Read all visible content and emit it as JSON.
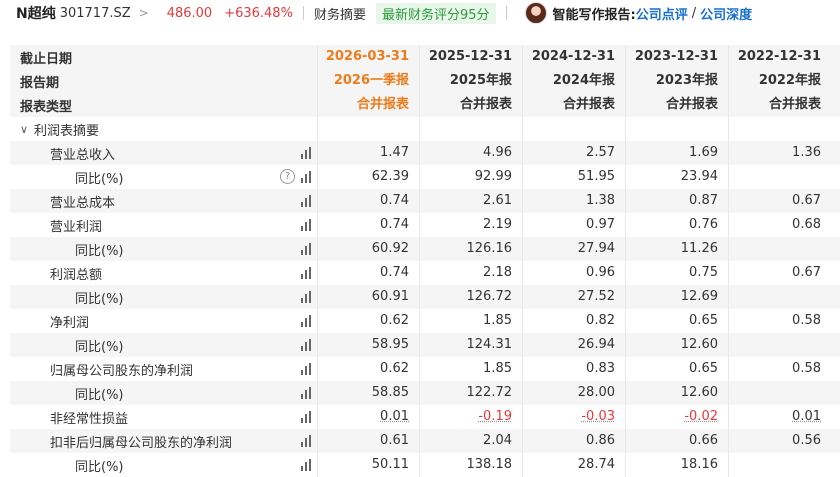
{
  "header": {
    "stock_name": "N超纯",
    "stock_code": "301717.SZ",
    "price": "486.00",
    "change_pct": "+636.48%",
    "summary_label": "财务摘要",
    "score_badge": "最新财务评分95分",
    "ai_label": "智能写作报告:",
    "link1": "公司点评",
    "link_sep": "/",
    "link2": "公司深度"
  },
  "table": {
    "header_labels": [
      "截止日期",
      "报告期",
      "报表类型"
    ],
    "columns": [
      {
        "date": "2026-03-31",
        "period": "2026一季报",
        "type": "合并报表"
      },
      {
        "date": "2025-12-31",
        "period": "2025年报",
        "type": "合并报表"
      },
      {
        "date": "2024-12-31",
        "period": "2024年报",
        "type": "合并报表"
      },
      {
        "date": "2023-12-31",
        "period": "2023年报",
        "type": "合并报表"
      },
      {
        "date": "2022-12-31",
        "period": "2022年报",
        "type": "合并报表"
      }
    ],
    "section": "利润表摘要",
    "rows": [
      {
        "label": "营业总收入",
        "v": [
          "1.47",
          "4.96",
          "2.57",
          "1.69",
          "1.36"
        ]
      },
      {
        "label": "同比(%)",
        "v": [
          "62.39",
          "92.99",
          "51.95",
          "23.94",
          ""
        ]
      },
      {
        "label": "营业总成本",
        "v": [
          "0.74",
          "2.61",
          "1.38",
          "0.87",
          "0.67"
        ]
      },
      {
        "label": "营业利润",
        "v": [
          "0.74",
          "2.19",
          "0.97",
          "0.76",
          "0.68"
        ]
      },
      {
        "label": "同比(%)",
        "v": [
          "60.92",
          "126.16",
          "27.94",
          "11.26",
          ""
        ]
      },
      {
        "label": "利润总额",
        "v": [
          "0.74",
          "2.18",
          "0.96",
          "0.75",
          "0.67"
        ]
      },
      {
        "label": "同比(%)",
        "v": [
          "60.91",
          "126.72",
          "27.52",
          "12.69",
          ""
        ]
      },
      {
        "label": "净利润",
        "v": [
          "0.62",
          "1.85",
          "0.82",
          "0.65",
          "0.58"
        ]
      },
      {
        "label": "同比(%)",
        "v": [
          "58.95",
          "124.31",
          "26.94",
          "12.60",
          ""
        ]
      },
      {
        "label": "归属母公司股东的净利润",
        "v": [
          "0.62",
          "1.85",
          "0.83",
          "0.65",
          "0.58"
        ]
      },
      {
        "label": "同比(%)",
        "v": [
          "58.85",
          "122.72",
          "28.00",
          "12.60",
          ""
        ]
      },
      {
        "label": "非经常性损益",
        "v": [
          "0.01",
          "-0.19",
          "-0.03",
          "-0.02",
          "0.01"
        ]
      },
      {
        "label": "扣非后归属母公司股东的净利润",
        "v": [
          "0.61",
          "2.04",
          "0.86",
          "0.66",
          "0.56"
        ]
      },
      {
        "label": "同比(%)",
        "v": [
          "50.11",
          "138.18",
          "28.74",
          "18.16",
          ""
        ]
      }
    ]
  },
  "colors": {
    "accent_orange": "#ee7b1a",
    "red": "#e4393c",
    "green": "#2b9b3e",
    "link": "#1a6fd0"
  }
}
